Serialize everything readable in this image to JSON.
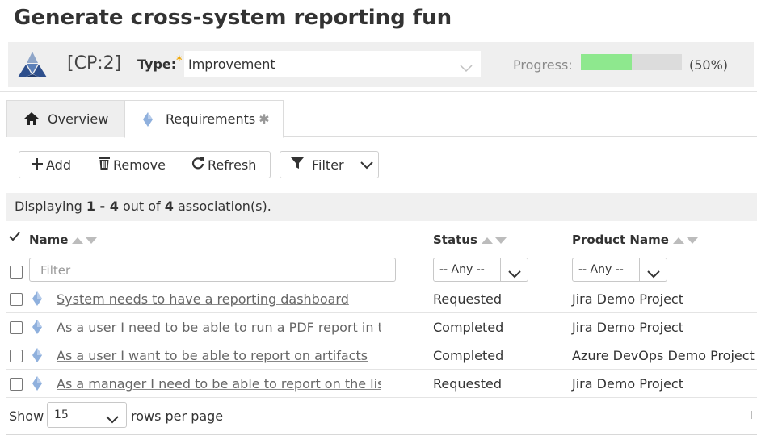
{
  "page": {
    "title": "Generate cross-system reporting fun"
  },
  "header": {
    "artifact_id": "[CP:2]",
    "type_label": "Type:",
    "required_marker": "*",
    "type_value": "Improvement",
    "progress_label": "Progress:",
    "progress_fraction": 0.5,
    "progress_text": "(50%)",
    "colors": {
      "progress_fill": "#8ee88e",
      "required": "#f0a500"
    }
  },
  "tabs": [
    {
      "label": "Overview",
      "icon": "home-icon"
    },
    {
      "label": "Requirements",
      "icon": "requirement-diamond-icon",
      "modified": "✱"
    }
  ],
  "toolbar": {
    "add_label": "Add",
    "remove_label": "Remove",
    "refresh_label": "Refresh",
    "filter_label": "Filter"
  },
  "summary": {
    "prefix": "Displaying ",
    "range": "1 - 4",
    "middle": " out of ",
    "total": "4",
    "suffix": " association(s)."
  },
  "table": {
    "columns": {
      "name": "Name",
      "status": "Status",
      "product": "Product Name"
    },
    "filter_placeholder": "Filter",
    "status_filter": "-- Any --",
    "product_filter": "-- Any --",
    "rows": [
      {
        "name": "System needs to have a reporting dashboard",
        "status": "Requested",
        "product": "Jira Demo Project"
      },
      {
        "name": "As a user I need to be able to run a PDF report in the system",
        "status": "Completed",
        "product": "Jira Demo Project"
      },
      {
        "name": "As a user I want to be able to report on artifacts",
        "status": "Completed",
        "product": "Azure DevOps Demo Project"
      },
      {
        "name": "As a manager I need to be able to report on the list of open items",
        "status": "Requested",
        "product": "Jira Demo Project"
      }
    ]
  },
  "pagination": {
    "show_label": "Show",
    "page_size": "15",
    "suffix_label": "rows per page"
  }
}
